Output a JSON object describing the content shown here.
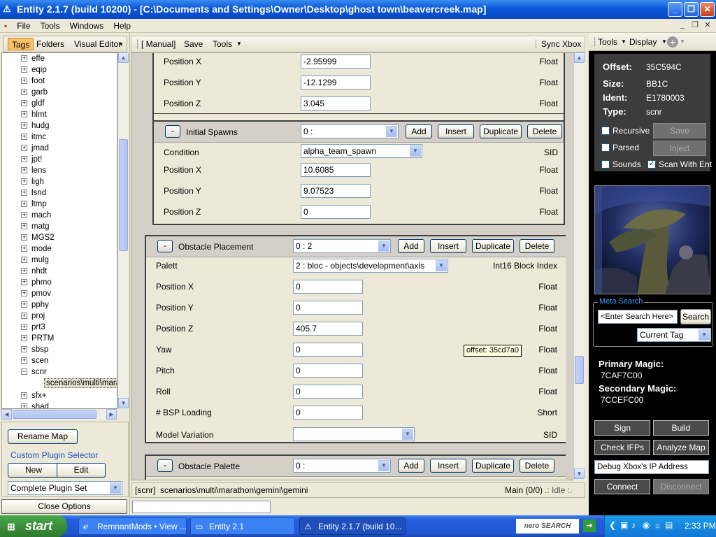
{
  "window": {
    "title": "Entity  2.1.7 (build 10200) - [C:\\Documents and Settings\\Owner\\Desktop\\ghost town\\beavercreek.map]",
    "buttons": [
      "_",
      "❐",
      "✕"
    ]
  },
  "menu": {
    "items": [
      "File",
      "Tools",
      "Windows",
      "Help"
    ],
    "mdi_buttons": [
      "_",
      "❐",
      "✕"
    ]
  },
  "left": {
    "tabs": [
      "Tags",
      "Folders",
      "Visual Editor"
    ],
    "tree_items": [
      "effe",
      "eqip",
      "foot",
      "garb",
      "gldf",
      "hlmt",
      "hudg",
      "itmc",
      "jmad",
      "jpt!",
      "lens",
      "ligh",
      "lsnd",
      "ltmp",
      "mach",
      "matg",
      "MGS2",
      "mode",
      "mulg",
      "nhdt",
      "phmo",
      "pmov",
      "pphy",
      "proj",
      "prt3",
      "PRTM",
      "sbsp",
      "scen",
      "scnr"
    ],
    "tree_child": "scenarios\\multi\\marat",
    "tree_after": [
      "sfx+",
      "shad"
    ],
    "rename_map": "Rename Map",
    "custom_plugin": "Custom Plugin Selector",
    "new": "New",
    "edit": "Edit",
    "plugin_set": "Complete Plugin Set",
    "close_options": "Close Options"
  },
  "center": {
    "toolbar": {
      "manual": "[ Manual]",
      "save": "Save",
      "tools": "Tools",
      "sync": "Sync Xbox"
    },
    "block0": {
      "rows": [
        {
          "label": "Position X",
          "value": "-2.95999",
          "type": "Float"
        },
        {
          "label": "Position Y",
          "value": "-12.1299",
          "type": "Float"
        },
        {
          "label": "Position Z",
          "value": "3.045",
          "type": "Float"
        }
      ]
    },
    "block1": {
      "title": "Initial Spawns",
      "index": "0 :",
      "buttons": [
        "Add",
        "Insert",
        "Duplicate",
        "Delete"
      ],
      "condition": {
        "label": "Condition",
        "value": "alpha_team_spawn",
        "type": "SID"
      },
      "rows": [
        {
          "label": "Position X",
          "value": "10.6085",
          "type": "Float"
        },
        {
          "label": "Position Y",
          "value": "9.07523",
          "type": "Float"
        },
        {
          "label": "Position Z",
          "value": "0",
          "type": "Float"
        }
      ]
    },
    "block2": {
      "title": "Obstacle Placement",
      "index": "0 : 2",
      "buttons": [
        "Add",
        "Insert",
        "Duplicate",
        "Delete"
      ],
      "palette": {
        "label": "Palett",
        "value": "2 : bloc - objects\\development\\axis",
        "type": "Int16 Block Index"
      },
      "rows": [
        {
          "label": "Position X",
          "value": "0",
          "type": "Float"
        },
        {
          "label": "Position Y",
          "value": "0",
          "type": "Float"
        },
        {
          "label": "Position Z",
          "value": "405.7",
          "type": "Float"
        },
        {
          "label": "Yaw",
          "value": "0",
          "type": "Float"
        },
        {
          "label": "Pitch",
          "value": "0",
          "type": "Float"
        },
        {
          "label": "Roll",
          "value": "0",
          "type": "Float"
        },
        {
          "label": "# BSP Loading",
          "value": "0",
          "type": "Short"
        }
      ],
      "variation": {
        "label": "Model Variation",
        "value": "",
        "type": "SID"
      }
    },
    "block3": {
      "title": "Obstacle Palette",
      "index": "0 :",
      "buttons": [
        "Add",
        "Insert",
        "Duplicate",
        "Delete"
      ]
    },
    "tooltip": "offset: 35cd7a0",
    "status": {
      "tag": "[scnr]",
      "path": "scenarios\\multi\\marathon\\gemini\\gemini",
      "main": "Main (0/0)",
      "idle": ".: Idle :."
    }
  },
  "right": {
    "toolbar": {
      "tools": "Tools",
      "display": "Display"
    },
    "info": [
      {
        "key": "Offset:",
        "value": "35C594C"
      },
      {
        "key": "Size:",
        "value": "BB1C"
      },
      {
        "key": "Ident:",
        "value": "E1780003"
      },
      {
        "key": "Type:",
        "value": "scnr"
      }
    ],
    "checks": {
      "recursive": {
        "label": "Recursive",
        "checked": false
      },
      "parsed": {
        "label": "Parsed",
        "checked": false
      },
      "sounds": {
        "label": "Sounds",
        "checked": false
      },
      "scan": {
        "label": "Scan With Ent",
        "checked": true
      }
    },
    "save": "Save",
    "inject": "Inject",
    "meta_search": {
      "title": "Meta Search",
      "placeholder": "<Enter Search Here>",
      "button": "Search",
      "scope": "Current Tag"
    },
    "primary_magic": {
      "label": "Primary Magic:",
      "value": "7CAF7C00"
    },
    "secondary_magic": {
      "label": "Secondary Magic:",
      "value": "7CCEFC00"
    },
    "sign": "Sign",
    "build": "Build",
    "check_ifps": "Check IFPs",
    "analyze_map": "Analyze Map",
    "debug_ip": "Debug  Xbox's  IP  Address",
    "connect": "Connect",
    "disconnect": "Disconnect"
  },
  "taskbar": {
    "start": "start",
    "tasks": [
      "RemnantMods • View ...",
      "Entity 2.1",
      "Entity  2.1.7 (build 10..."
    ],
    "search_logo": "nero SEARCH",
    "clock": "2:33 PM"
  }
}
